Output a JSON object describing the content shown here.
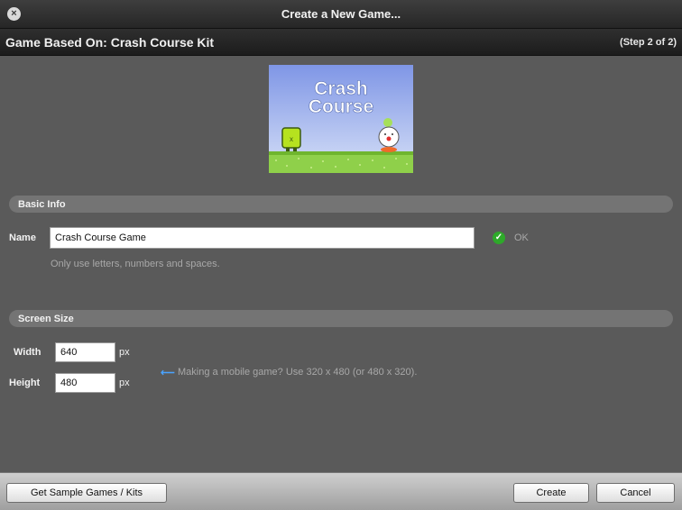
{
  "window": {
    "title": "Create a New Game...",
    "close_glyph": "×"
  },
  "header": {
    "title": "Game Based On: Crash Course Kit",
    "step": "(Step 2 of 2)"
  },
  "thumbnail": {
    "title_line1": "Crash",
    "title_line2": "Course",
    "sky_top_color": "#7f96e6",
    "sky_bottom_color": "#c7d3f4",
    "ground_color": "#8fd04a",
    "icon": "game-thumbnail"
  },
  "basic_info": {
    "section_title": "Basic Info",
    "name_label": "Name",
    "name_value": "Crash Course Game",
    "ok_glyph": "✓",
    "ok_text": "OK",
    "hint": "Only use letters, numbers and spaces."
  },
  "screen_size": {
    "section_title": "Screen Size",
    "width_label": "Width",
    "width_value": "640",
    "height_label": "Height",
    "height_value": "480",
    "unit": "px",
    "arrow_glyph": "⟵",
    "mobile_hint": "Making a mobile game? Use 320 x 480 (or 480 x 320)."
  },
  "footer": {
    "sample_button": "Get Sample Games / Kits",
    "create_button": "Create",
    "cancel_button": "Cancel"
  }
}
